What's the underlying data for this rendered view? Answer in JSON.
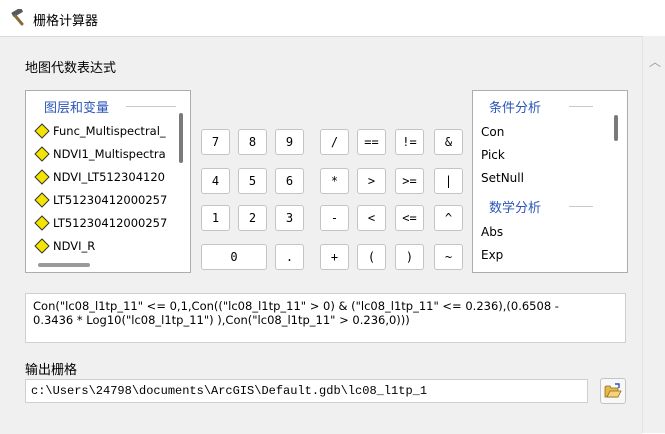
{
  "window": {
    "title": "栅格计算器",
    "icon": "hammer-icon"
  },
  "expression_section": {
    "label": "地图代数表达式"
  },
  "layers_panel": {
    "heading": "图层和变量",
    "items": [
      {
        "label": "Func_Multispectral_"
      },
      {
        "label": "NDVI1_Multispectra"
      },
      {
        "label": "NDVI_LT512304120"
      },
      {
        "label": "LT51230412000257"
      },
      {
        "label": "LT51230412000257"
      },
      {
        "label": "NDVI_R"
      }
    ],
    "item_icon": "diamond-layer-icon",
    "item_icon_color": "#f5e400"
  },
  "calculator": {
    "numpad": [
      "7",
      "8",
      "9",
      "4",
      "5",
      "6",
      "1",
      "2",
      "3",
      "0",
      "."
    ],
    "operators": [
      "/",
      "==",
      "!=",
      "&",
      "*",
      ">",
      ">=",
      "|",
      "-",
      "<",
      "<=",
      "^",
      "+",
      "(",
      ")",
      "~"
    ]
  },
  "functions_panel": {
    "groups": [
      {
        "heading": "条件分析",
        "items": [
          "Con",
          "Pick",
          "SetNull"
        ]
      },
      {
        "heading": "数学分析",
        "items": [
          "Abs",
          "Exp"
        ]
      }
    ]
  },
  "expression": {
    "line1": "Con(\"lc08_l1tp_11\" <= 0,1,Con((\"lc08_l1tp_11\" > 0) & (\"lc08_l1tp_11\" <= 0.236),(0.6508 -",
    "line2": "0.3436 * Log10(\"lc08_l1tp_11\") ),Con(\"lc08_l1tp_11\" > 0.236,0)))"
  },
  "output": {
    "label": "输出栅格",
    "value": "c:\\Users\\24798\\documents\\ArcGIS\\Default.gdb\\lc08_l1tp_1",
    "browse_icon": "open-folder-icon"
  },
  "colors": {
    "accent": "#2b56b8",
    "panel_bg": "#f0f0f0"
  }
}
